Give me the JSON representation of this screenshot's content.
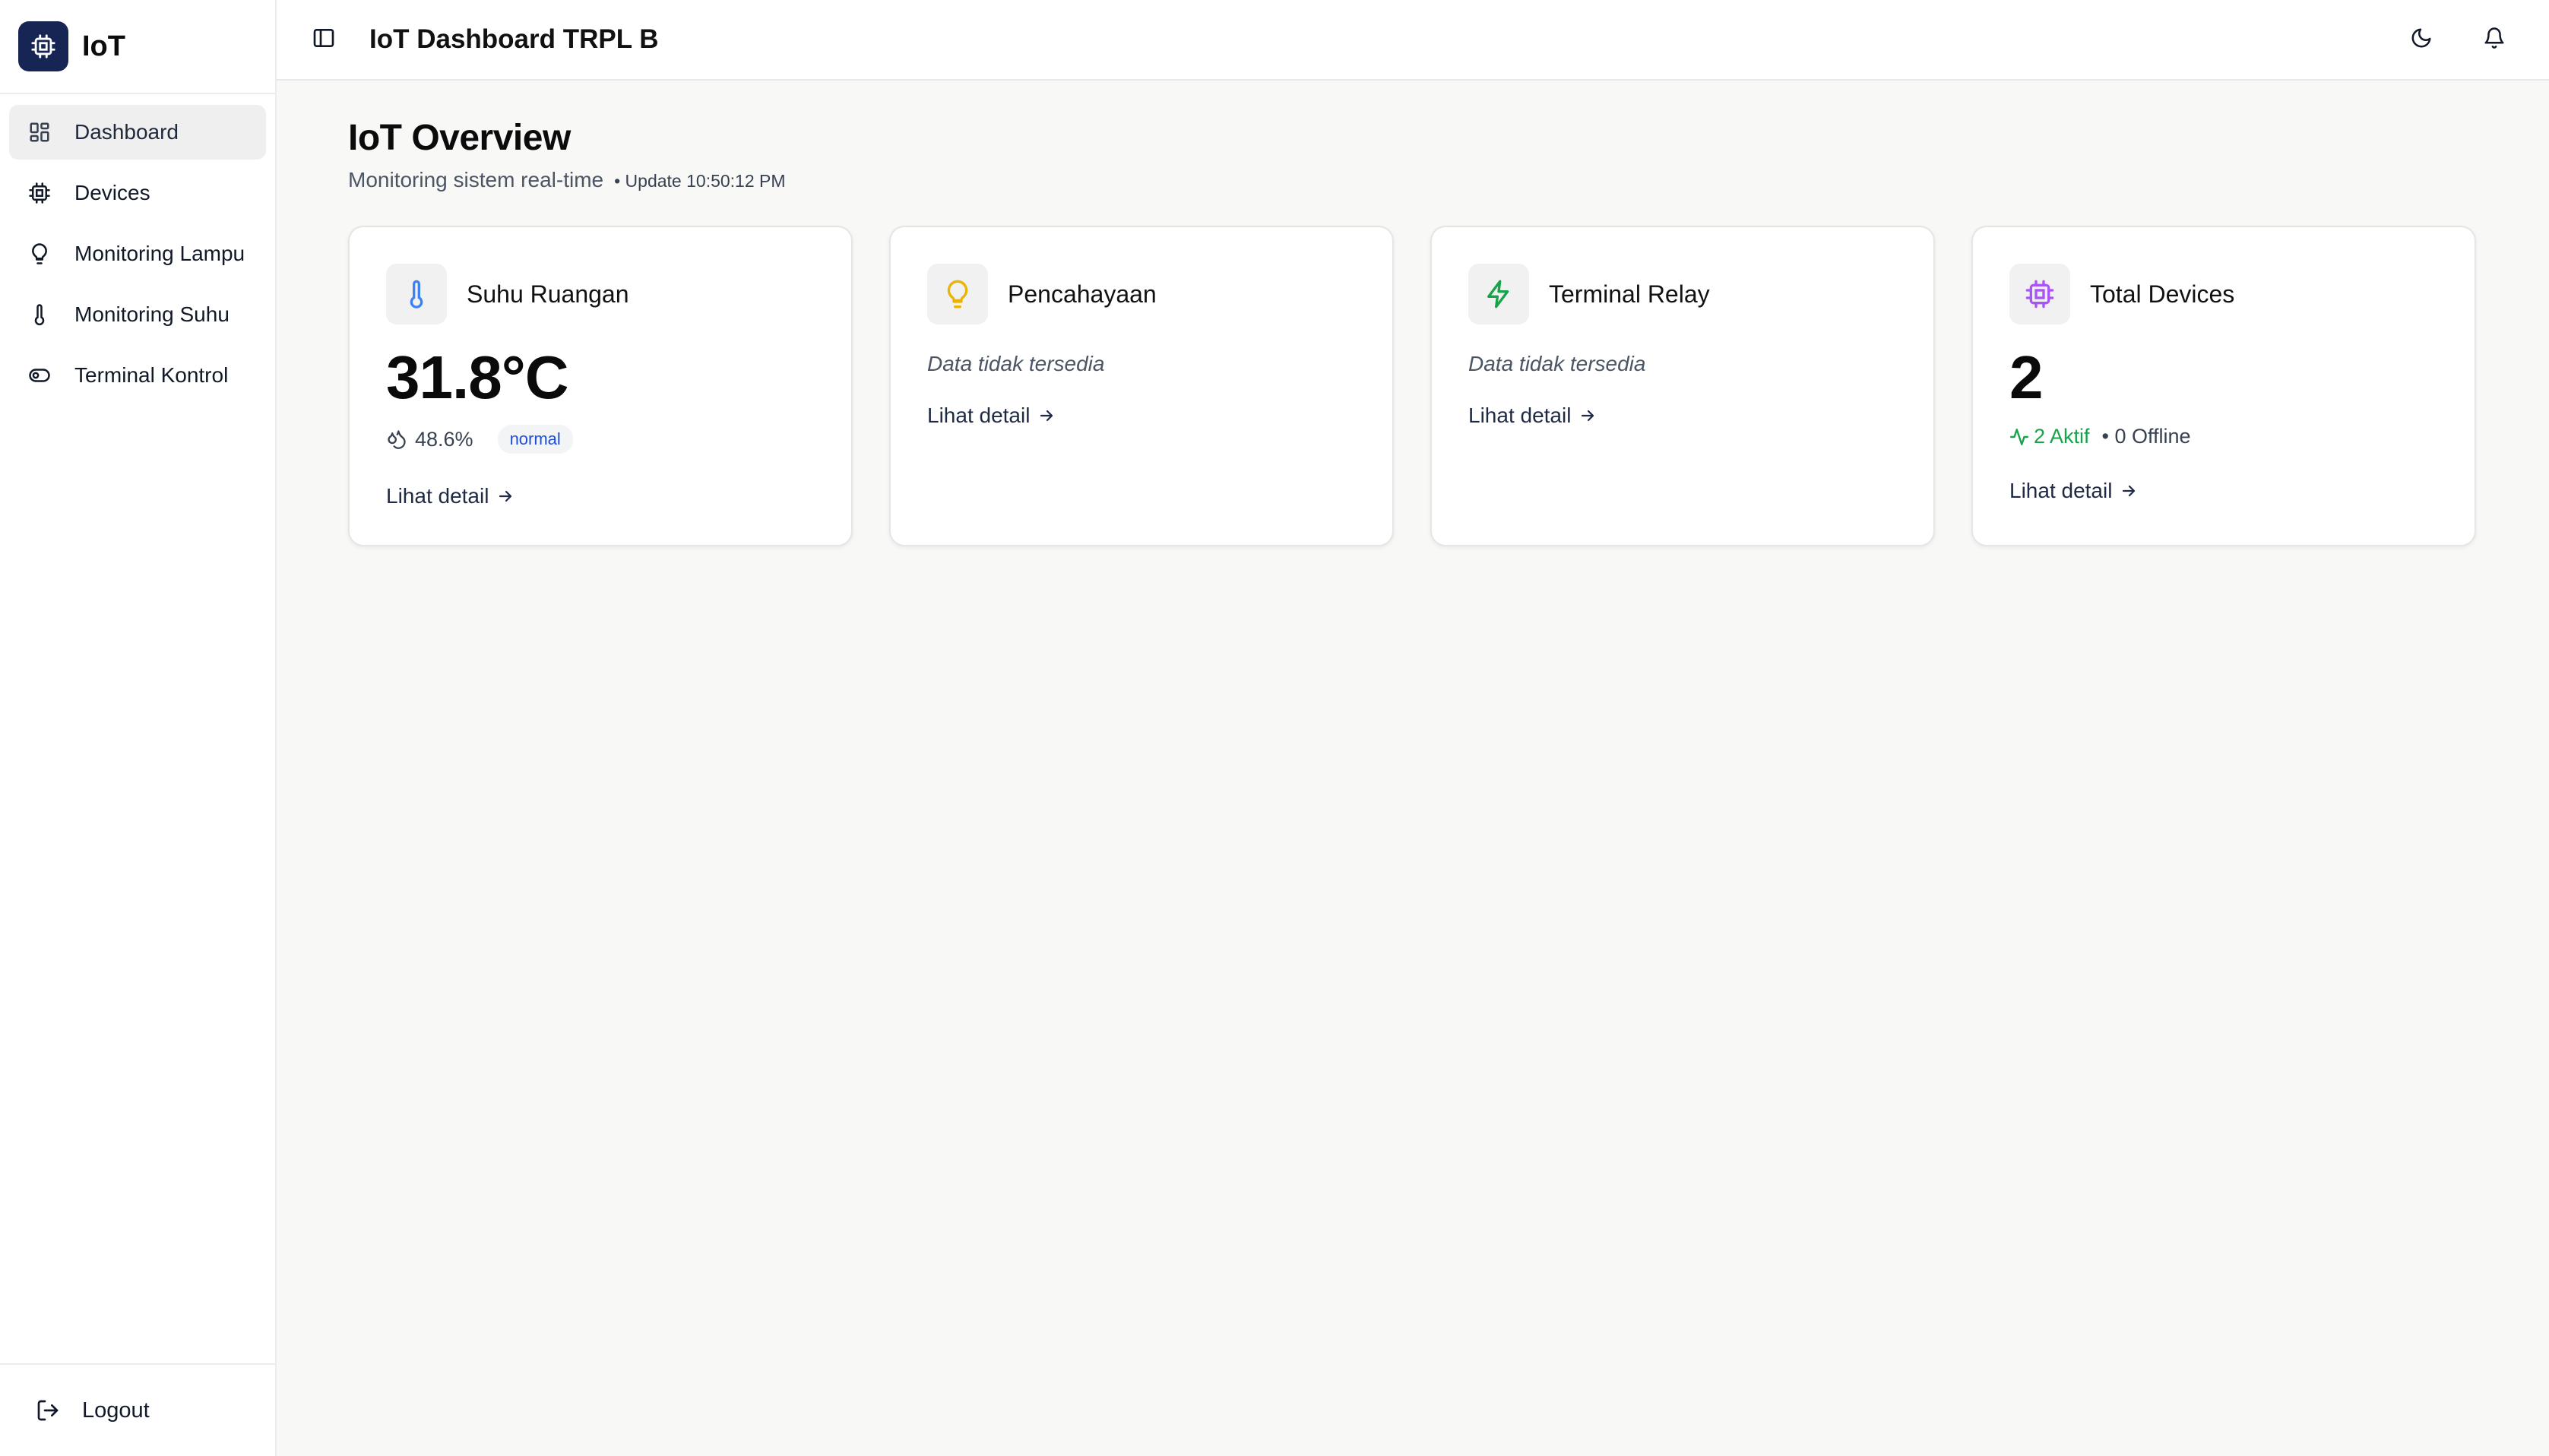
{
  "brand": {
    "name": "IoT"
  },
  "sidebar": {
    "items": [
      {
        "label": "Dashboard",
        "icon": "grid-icon",
        "active": true
      },
      {
        "label": "Devices",
        "icon": "chip-icon"
      },
      {
        "label": "Monitoring Lampu",
        "icon": "bulb-icon"
      },
      {
        "label": "Monitoring Suhu",
        "icon": "thermometer-icon"
      },
      {
        "label": "Terminal Kontrol",
        "icon": "toggle-icon"
      }
    ],
    "logout_label": "Logout"
  },
  "header": {
    "title": "IoT Dashboard TRPL B"
  },
  "page": {
    "title": "IoT Overview",
    "subtitle": "Monitoring sistem real-time",
    "update": "• Update 10:50:12 PM"
  },
  "cards": {
    "temperature": {
      "title": "Suhu Ruangan",
      "value": "31.8°C",
      "humidity": "48.6%",
      "status": "normal",
      "link": "Lihat detail"
    },
    "lighting": {
      "title": "Pencahayaan",
      "empty": "Data tidak tersedia",
      "link": "Lihat detail"
    },
    "relay": {
      "title": "Terminal Relay",
      "empty": "Data tidak tersedia",
      "link": "Lihat detail"
    },
    "devices": {
      "title": "Total Devices",
      "value": "2",
      "active": "2 Aktif",
      "offline": "• 0 Offline",
      "link": "Lihat detail"
    }
  },
  "colors": {
    "brand": "#172554",
    "thermometer": "#3b82f6",
    "bulb": "#eab308",
    "relay": "#16a34a",
    "chip": "#a855f7",
    "active": "#16a34a",
    "badge_text": "#1d4ed8"
  }
}
